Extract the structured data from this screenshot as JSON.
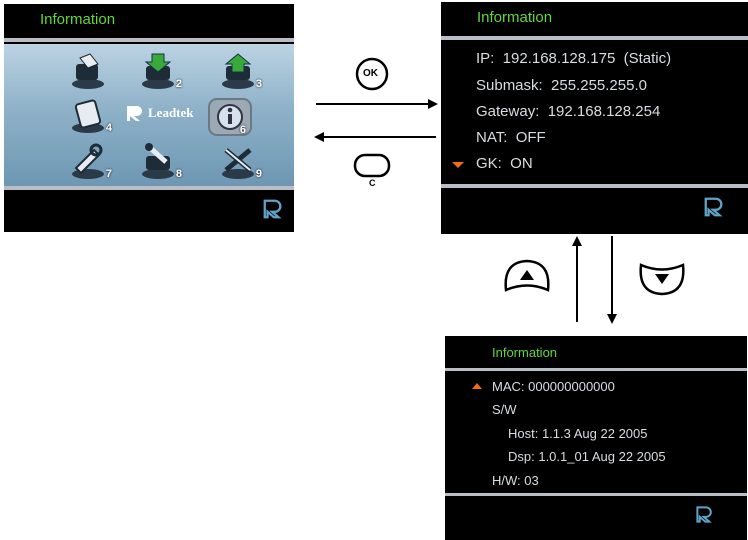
{
  "screen1": {
    "title": "Information",
    "logo_text": "Leadtek",
    "menu_numbers": [
      "2",
      "3",
      "4",
      "6",
      "7",
      "8",
      "9"
    ],
    "selected_item": "6"
  },
  "screen2": {
    "title": "Information",
    "lines": [
      "IP:  192.168.128.175  (Static)",
      "Submask:  255.255.255.0",
      "Gateway:  192.168.128.254",
      "NAT:  OFF",
      "GK:  ON"
    ]
  },
  "screen3": {
    "title": "Information",
    "lines": [
      "MAC: 000000000000",
      "S/W",
      "Host: 1.1.3 Aug 22 2005",
      "Dsp: 1.0.1_01 Aug 22 2005",
      "H/W: 03"
    ]
  },
  "buttons": {
    "ok_label": "OK",
    "c_label": "C"
  },
  "colors": {
    "title_green": "#63d63a",
    "scroll_orange": "#f26a1b",
    "divider_gray": "#b9bec4",
    "text_gray": "#d9dde1"
  },
  "icons": [
    "menu-item-icon",
    "leadtek-logo-icon",
    "information-icon",
    "scroll-up-indicator-icon",
    "scroll-down-indicator-icon",
    "ok-button-icon",
    "c-button-icon",
    "up-button-icon",
    "down-button-icon",
    "arrow-right-icon",
    "arrow-left-icon",
    "arrow-up-icon",
    "arrow-down-icon"
  ]
}
